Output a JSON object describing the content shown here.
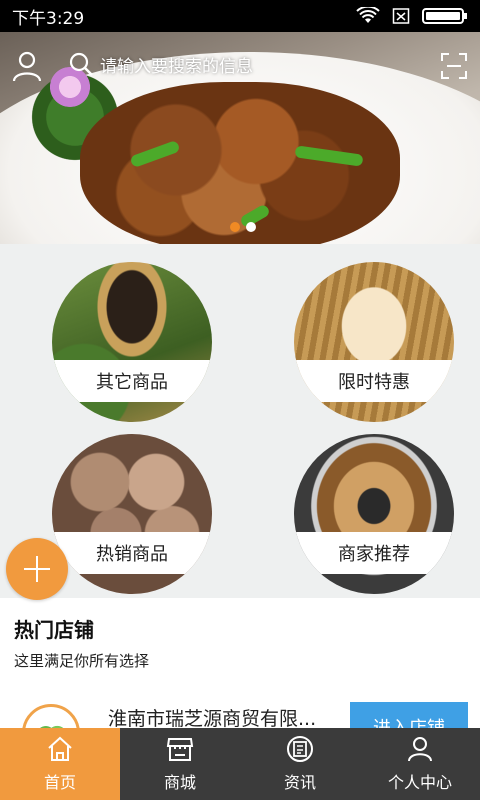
{
  "status_bar": {
    "time": "下午3:29",
    "icons": [
      "wifi-icon",
      "sim-off-icon",
      "battery-icon"
    ]
  },
  "header": {
    "search_placeholder": "请输入要搜索的信息",
    "left_icon": "user-icon",
    "right_icon": "scan-icon"
  },
  "banner": {
    "slide_count": 2,
    "active_slide": 1
  },
  "categories": [
    {
      "label": "其它商品"
    },
    {
      "label": "限时特惠"
    },
    {
      "label": "热销商品"
    },
    {
      "label": "商家推荐"
    }
  ],
  "fab": {
    "icon": "plus-icon"
  },
  "hot_shops": {
    "title": "热门店铺",
    "subtitle": "这里满足你所有选择",
    "items": [
      {
        "name": "淮南市瑞芝源商贸有限...",
        "button": "进入店铺"
      }
    ]
  },
  "bottom_nav": {
    "items": [
      {
        "label": "首页",
        "icon": "home-icon",
        "active": true
      },
      {
        "label": "商城",
        "icon": "store-icon",
        "active": false
      },
      {
        "label": "资讯",
        "icon": "news-icon",
        "active": false
      },
      {
        "label": "个人中心",
        "icon": "person-icon",
        "active": false
      }
    ]
  },
  "colors": {
    "accent": "#f19a3e",
    "nav_background": "#3b3b3b",
    "button_blue": "#3fa0e5",
    "active_dot": "#f08a24"
  }
}
